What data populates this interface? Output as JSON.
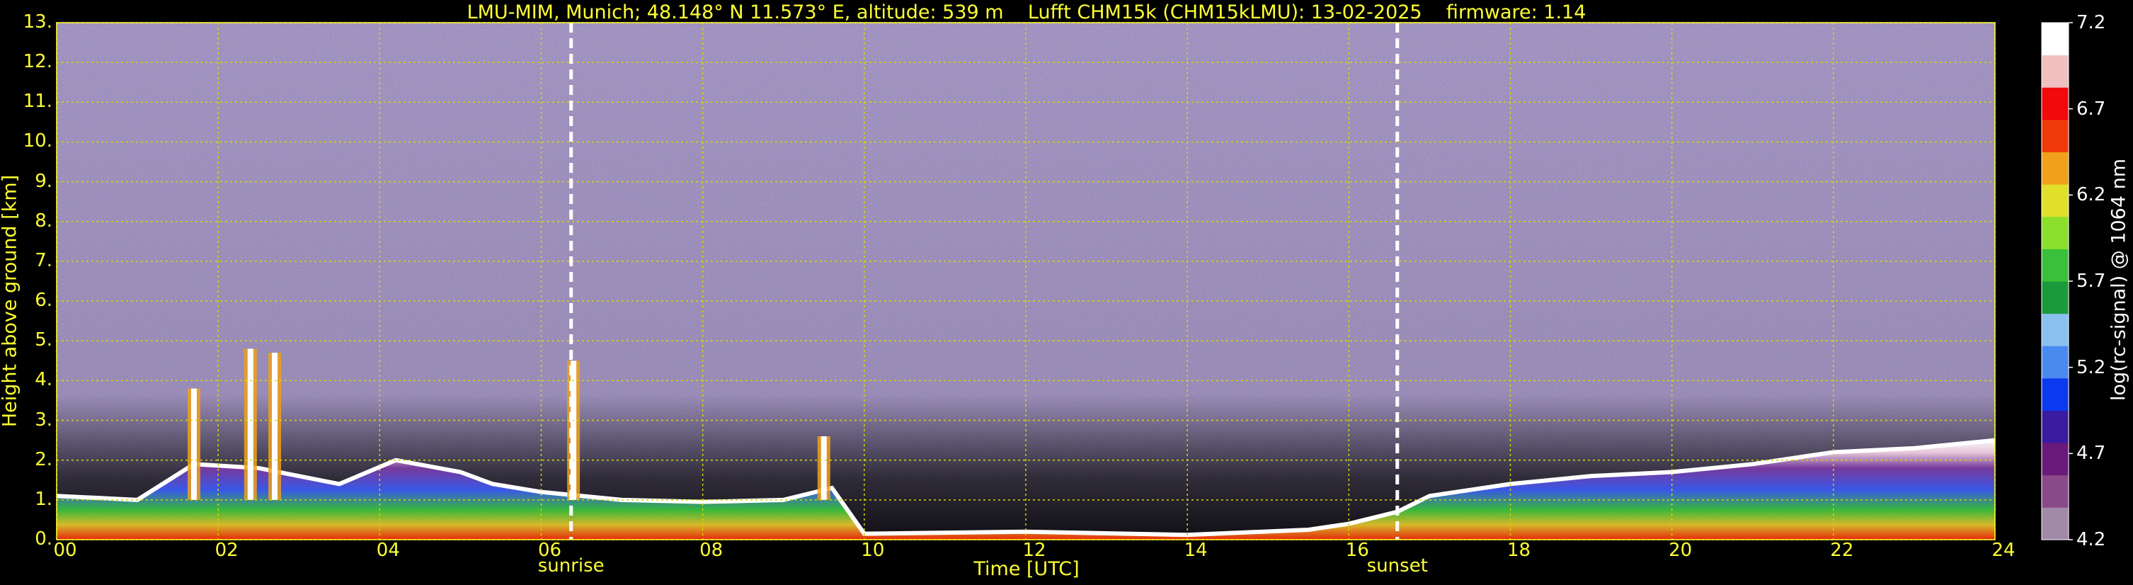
{
  "title": "LMU-MIM, Munich; 48.148° N 11.573° E, altitude: 539 m    Lufft CHM15k (CHM15kLMU): 13-02-2025    firmware: 1.14",
  "chart_data": {
    "type": "heatmap",
    "title": "LMU-MIM, Munich; 48.148° N 11.573° E, altitude: 539 m    Lufft CHM15k (CHM15kLMU): 13-02-2025    firmware: 1.14",
    "xlabel": "Time [UTC]",
    "ylabel": "Height above ground [km]",
    "xlim": [
      0,
      24
    ],
    "ylim": [
      0,
      13
    ],
    "x_ticks": [
      "00",
      "02",
      "04",
      "06",
      "08",
      "10",
      "12",
      "14",
      "16",
      "18",
      "20",
      "22",
      "24"
    ],
    "y_ticks": [
      "0.",
      "1.",
      "2.",
      "3.",
      "4.",
      "5.",
      "6.",
      "7.",
      "8.",
      "9.",
      "10.",
      "11.",
      "12.",
      "13."
    ],
    "grid": true,
    "events": [
      {
        "label": "sunrise",
        "time": 6.37
      },
      {
        "label": "sunset",
        "time": 16.6
      }
    ],
    "colorbar": {
      "label": "log(rc-signal) @ 1064 nm",
      "range": [
        4.2,
        7.2
      ],
      "ticks": [
        "4.2",
        "4.7",
        "5.2",
        "5.7",
        "6.2",
        "6.7",
        "7.2"
      ]
    },
    "boundary_layer_top_km": [
      [
        0,
        1.1
      ],
      [
        1,
        1.0
      ],
      [
        1.7,
        1.9
      ],
      [
        2.5,
        1.8
      ],
      [
        3.5,
        1.4
      ],
      [
        4.2,
        2.0
      ],
      [
        5,
        1.7
      ],
      [
        5.4,
        1.4
      ],
      [
        6,
        1.2
      ],
      [
        7,
        1.0
      ],
      [
        8,
        0.95
      ],
      [
        9,
        1.0
      ],
      [
        9.6,
        1.3
      ],
      [
        10,
        0.15
      ],
      [
        12,
        0.2
      ],
      [
        14,
        0.12
      ],
      [
        15.5,
        0.25
      ],
      [
        16,
        0.4
      ],
      [
        16.6,
        0.7
      ],
      [
        17,
        1.1
      ],
      [
        18,
        1.4
      ],
      [
        19,
        1.6
      ],
      [
        20,
        1.7
      ],
      [
        21,
        1.9
      ],
      [
        22,
        2.2
      ],
      [
        23,
        2.3
      ],
      [
        24,
        2.5
      ]
    ],
    "cloud_plumes": [
      {
        "time": 1.7,
        "top_km": 3.8
      },
      {
        "time": 2.4,
        "top_km": 4.8
      },
      {
        "time": 2.7,
        "top_km": 4.7
      },
      {
        "time": 6.4,
        "top_km": 4.5
      },
      {
        "time": 9.5,
        "top_km": 2.6
      }
    ],
    "background_color": "#4a3d78",
    "high_signal_color": "#ffffff",
    "palette": [
      "#a08aa8",
      "#8a4a8a",
      "#6a1a7a",
      "#3a1aa0",
      "#0a3af0",
      "#4a8af0",
      "#8ac0f0",
      "#1a9a3a",
      "#3ac03a",
      "#8ae02a",
      "#e0e02a",
      "#f0a01a",
      "#f03a0a",
      "#f00a0a",
      "#f0c0c0",
      "#ffffff"
    ]
  }
}
